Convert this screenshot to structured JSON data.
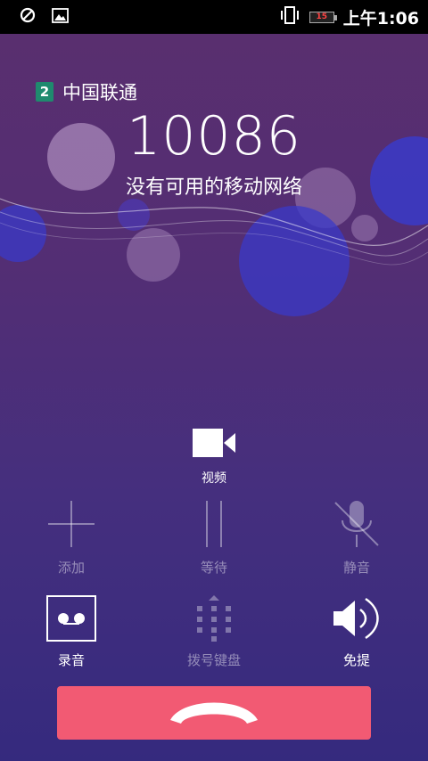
{
  "status_bar": {
    "left_icons": [
      "block-icon",
      "image-icon"
    ],
    "battery_level": "15",
    "time": "上午1:06"
  },
  "call": {
    "sim_slot": "2",
    "carrier": "中国联通",
    "number": "10086",
    "status": "没有可用的移动网络"
  },
  "video": {
    "label": "视频",
    "icon": "video-camera-icon"
  },
  "controls_row1": [
    {
      "label": "添加",
      "icon": "add-call-icon",
      "enabled": false
    },
    {
      "label": "等待",
      "icon": "hold-icon",
      "enabled": false
    },
    {
      "label": "静音",
      "icon": "mute-icon",
      "enabled": false
    }
  ],
  "controls_row2": [
    {
      "label": "录音",
      "icon": "record-icon",
      "enabled": true
    },
    {
      "label": "拨号键盘",
      "icon": "dialpad-icon",
      "enabled": false
    },
    {
      "label": "免提",
      "icon": "speaker-icon",
      "enabled": true
    }
  ],
  "end_call": {
    "icon": "end-call-icon",
    "color": "#f25a73"
  },
  "colors": {
    "background_top": "#5a2f6e",
    "background_bottom": "#352a7e",
    "sim_badge": "#1f8a6e"
  }
}
